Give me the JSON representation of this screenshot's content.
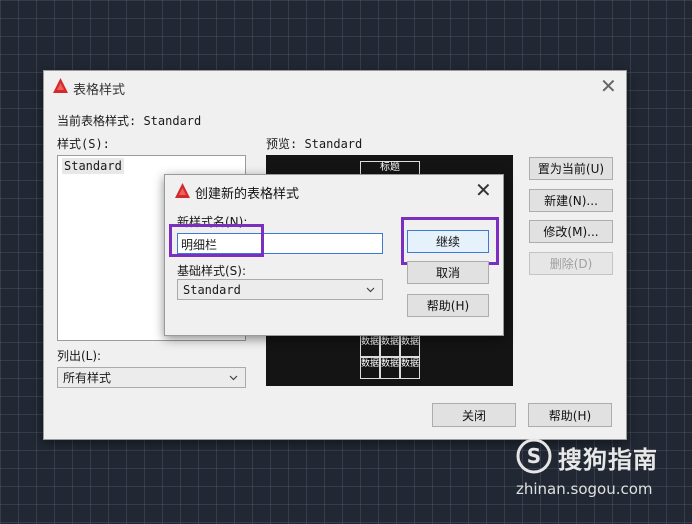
{
  "main_dialog": {
    "title": "表格样式",
    "current_style_label": "当前表格样式: Standard",
    "styles_label": "样式(S):",
    "styles_list": [
      "Standard"
    ],
    "preview_label": "预览: Standard",
    "preview_header": "标题",
    "preview_cells": [
      "数据",
      "数据",
      "数据",
      "数据",
      "数据",
      "数据"
    ],
    "list_label": "列出(L):",
    "list_value": "所有样式",
    "set_current_button": "置为当前(U)",
    "new_button": "新建(N)...",
    "modify_button": "修改(M)...",
    "delete_button": "删除(D)",
    "close_button": "关闭",
    "help_button": "帮助(H)"
  },
  "new_style_dialog": {
    "title": "创建新的表格样式",
    "new_name_label": "新样式名(N):",
    "new_name_value": "明细栏",
    "base_style_label": "基础样式(S):",
    "base_style_value": "Standard",
    "continue_button": "继续",
    "cancel_button": "取消",
    "help_button": "帮助(H)"
  },
  "watermark": {
    "brand": "搜狗指南",
    "url": "zhinan.sogou.com"
  },
  "colors": {
    "highlight": "#7a2fc0",
    "logo_red": "#d22b2b",
    "background": "#212833"
  }
}
